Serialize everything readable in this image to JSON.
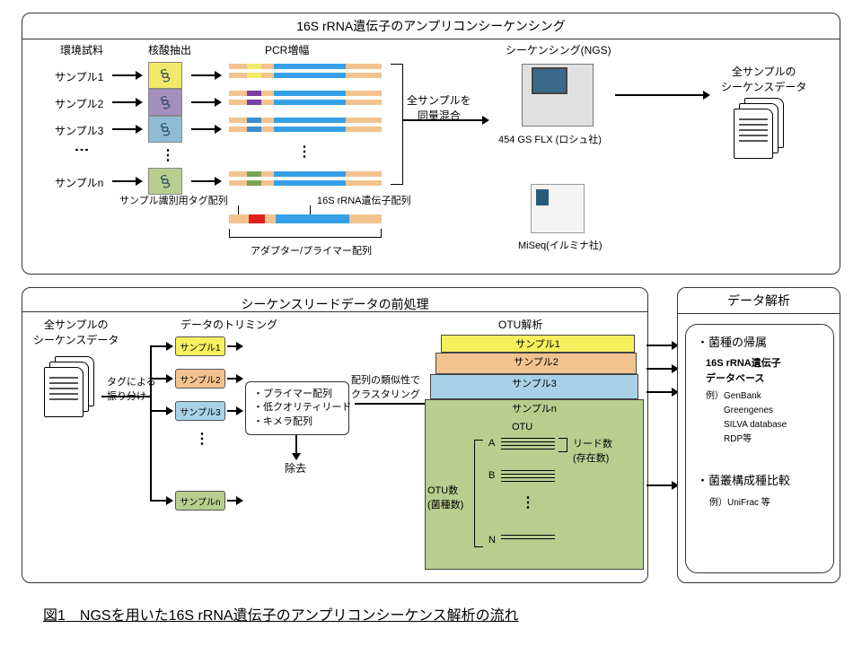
{
  "panel1": {
    "title": "16S rRNA遺伝子のアンプリコンシーケンシング",
    "col1": "環境試料",
    "col2": "核酸抽出",
    "col3": "PCR増幅",
    "col4": "シーケンシング(NGS)",
    "samples": {
      "s1": "サンプル1",
      "s2": "サンプル2",
      "s3": "サンプル3",
      "sn": "サンプルn"
    },
    "mix": "全サンプルを\n同量混合",
    "seq1": "454 GS FLX (ロシュ社)",
    "seq2": "MiSeq(イルミナ社)",
    "out_t": "全サンプルの\nシーケンスデータ",
    "tag_lbl": "サンプル識別用タグ配列",
    "ampl_lbl": "16S rRNA遺伝子配列",
    "adapter_lbl": "アダプター/プライマー配列"
  },
  "panel2": {
    "title": "シーケンスリードデータの前処理",
    "in_t": "全サンプルの\nシーケンスデータ",
    "sort": "タグによる\n振り分け",
    "trim_t": "データのトリミング",
    "s1": "サンプル1",
    "s2": "サンプル2",
    "s3": "サンプル3",
    "sn": "サンプルn",
    "trim_items": "・プライマー配列\n・低クオリティリード\n・キメラ配列",
    "remove": "除去",
    "cluster": "配列の類似性で\nクラスタリング",
    "otu_t": "OTU解析",
    "otu": "OTU",
    "reads": "リード数\n(存在数)",
    "otu_n": "OTU数\n(菌種数)",
    "a": "A",
    "b": "B",
    "n": "N"
  },
  "panel3": {
    "title": "データ解析",
    "item1": "・菌種の帰属",
    "db_t": "16S rRNA遺伝子\nデータベース",
    "db_ex": "例）GenBank\n　　Greengenes\n　　SILVA database\n　　RDP等",
    "item2": "・菌叢構成種比較",
    "ex2": "例）UniFrac 等"
  },
  "caption": "図1　NGSを用いた16S rRNA遺伝子のアンプリコンシーケンス解析の流れ"
}
